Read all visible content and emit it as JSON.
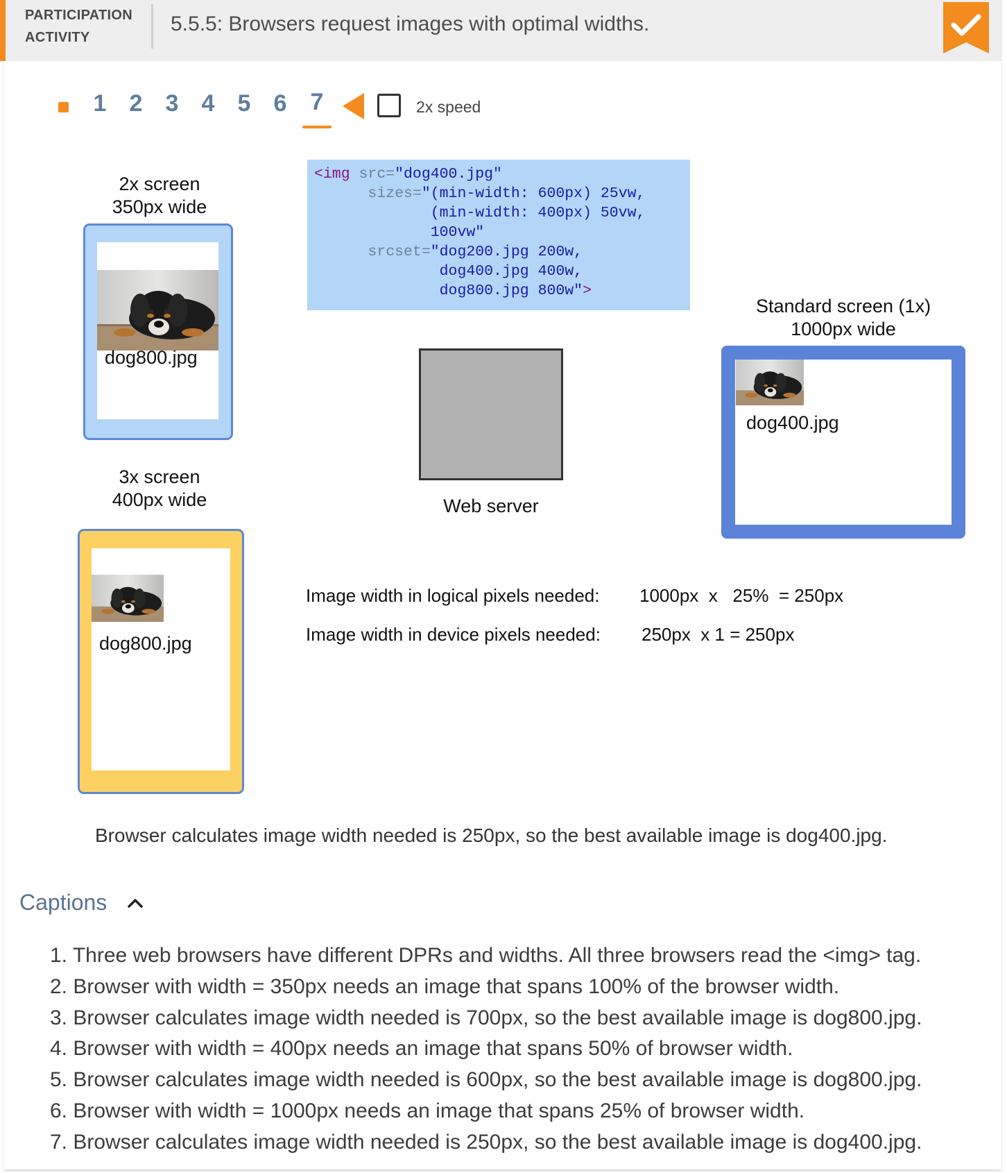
{
  "header": {
    "tag_line1": "PARTICIPATION",
    "tag_line2": "ACTIVITY",
    "title": "5.5.5: Browsers request images with optimal widths.",
    "completed_icon": "orange-bookmark-check-icon"
  },
  "controls": {
    "steps": [
      "1",
      "2",
      "3",
      "4",
      "5",
      "6",
      "7"
    ],
    "active_step": "7",
    "speed_label": "2x speed",
    "speed_checked": false
  },
  "code": {
    "line1_tag": "<img",
    "line1_attr": " src=",
    "line1_val": "\"dog400.jpg\"",
    "line2_attr": "sizes=",
    "line2_val": "\"(min-width: 600px) 25vw,",
    "line3_val": "(min-width: 400px) 50vw,",
    "line4_val": "100vw\"",
    "line5_attr": "srcset=",
    "line5_val": "\"dog200.jpg 200w,",
    "line6_val": "dog400.jpg 400w,",
    "line7_val": "dog800.jpg 800w\"",
    "line7_close": ">"
  },
  "screens": {
    "twox": {
      "line1": "2x screen",
      "line2": "350px wide",
      "file": "dog800.jpg"
    },
    "threex": {
      "line1": "3x screen",
      "line2": "400px wide",
      "file": "dog800.jpg"
    },
    "standard": {
      "line1": "Standard screen (1x)",
      "line2": "1000px wide",
      "file": "dog400.jpg"
    }
  },
  "server": {
    "label": "Web server"
  },
  "calc": {
    "logical_label": "Image width in logical pixels needed:",
    "logical_value": "1000px  x   25%  = 250px",
    "device_label": "Image width in device pixels needed:",
    "device_value": "250px  x 1 = 250px"
  },
  "summary": "Browser calculates image width needed is 250px, so the best available image is dog400.jpg.",
  "captions": {
    "title": "Captions",
    "items": [
      "1. Three web browsers have different DPRs and widths. All three browsers read the <img> tag.",
      "2. Browser with width = 350px needs an image that spans 100% of the browser width.",
      "3. Browser calculates image width needed is 700px, so the best available image is dog800.jpg.",
      "4. Browser with width = 400px needs an image that spans 50% of browser width.",
      "5. Browser calculates image width needed is 600px, so the best available image is dog800.jpg.",
      "6. Browser with width = 1000px needs an image that spans 25% of browser width.",
      "7. Browser calculates image width needed is 250px, so the best available image is dog400.jpg."
    ]
  },
  "colors": {
    "accent": "#f38b1e",
    "step_text": "#5e7d9f",
    "code_bg": "#b3d6f8",
    "phone_2x_bg": "#b3d6f8",
    "phone_3x_bg": "#fdd161",
    "desktop_border": "#5b84d8",
    "server_fill": "#b1b1b1"
  }
}
